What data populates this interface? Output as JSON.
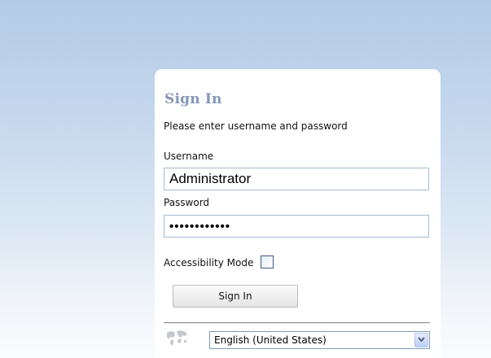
{
  "form": {
    "title": "Sign In",
    "instructions": "Please enter username and password",
    "username_label": "Username",
    "username_value": "Administrator",
    "password_label": "Password",
    "password_value": "••••••••••••",
    "accessibility_label": "Accessibility Mode",
    "accessibility_checked": false,
    "signin_button": "Sign In"
  },
  "language": {
    "selected": "English (United States)",
    "icon": "globe-icon",
    "dropdown_icon": "chevron-down-icon"
  },
  "colors": {
    "title": "#8696b8",
    "background_top": "#b3cbe6",
    "background_bottom": "#fbfcfe",
    "input_border": "#a5bcd2"
  }
}
